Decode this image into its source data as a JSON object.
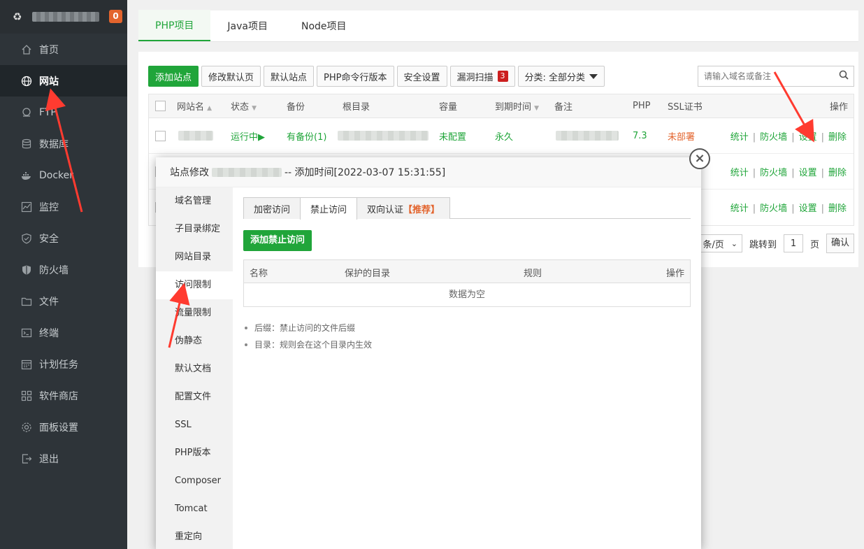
{
  "sidebar": {
    "badge": "0",
    "items": [
      {
        "label": "首页",
        "icon": "home-icon"
      },
      {
        "label": "网站",
        "icon": "globe-icon"
      },
      {
        "label": "FTP",
        "icon": "ftp-icon"
      },
      {
        "label": "数据库",
        "icon": "database-icon"
      },
      {
        "label": "Docker",
        "icon": "docker-icon"
      },
      {
        "label": "监控",
        "icon": "monitor-icon"
      },
      {
        "label": "安全",
        "icon": "shield-icon"
      },
      {
        "label": "防火墙",
        "icon": "firewall-icon"
      },
      {
        "label": "文件",
        "icon": "folder-icon"
      },
      {
        "label": "终端",
        "icon": "terminal-icon"
      },
      {
        "label": "计划任务",
        "icon": "calendar-icon"
      },
      {
        "label": "软件商店",
        "icon": "apps-icon"
      },
      {
        "label": "面板设置",
        "icon": "gear-icon"
      },
      {
        "label": "退出",
        "icon": "logout-icon"
      }
    ]
  },
  "project_tabs": [
    "PHP项目",
    "Java项目",
    "Node项目"
  ],
  "toolbar": {
    "add_site": "添加站点",
    "modify_default_page": "修改默认页",
    "default_site": "默认站点",
    "php_cli": "PHP命令行版本",
    "security": "安全设置",
    "vuln_scan": "漏洞扫描",
    "vuln_count": "3",
    "category": "分类: 全部分类"
  },
  "search": {
    "placeholder": "请输入域名或备注"
  },
  "table": {
    "headers": {
      "name": "网站名",
      "status": "状态",
      "backup": "备份",
      "root": "根目录",
      "capacity": "容量",
      "expire": "到期时间",
      "note": "备注",
      "php": "PHP",
      "ssl": "SSL证书",
      "ops": "操作"
    },
    "row": {
      "status": "运行中▶",
      "backup": "有备份(1)",
      "capacity": "未配置",
      "expire": "永久",
      "php": "7.3",
      "ssl": "未部署"
    },
    "ops": [
      "统计",
      "防火墙",
      "设置",
      "删除"
    ]
  },
  "pager": {
    "per_page": "条/页",
    "jump": "跳转到",
    "page_value": "1",
    "page_unit": "页",
    "confirm": "确认"
  },
  "modal": {
    "title_prefix": "站点修改",
    "title_suffix": "-- 添加时间[2022-03-07 15:31:55]",
    "close": "×",
    "menu": [
      "域名管理",
      "子目录绑定",
      "网站目录",
      "访问限制",
      "流量限制",
      "伪静态",
      "默认文档",
      "配置文件",
      "SSL",
      "PHP版本",
      "Composer",
      "Tomcat",
      "重定向"
    ],
    "tabs": {
      "encrypt": "加密访问",
      "deny": "禁止访问",
      "two_way": "双向认证",
      "recommend": "【推荐】"
    },
    "add_button": "添加禁止访问",
    "inner_headers": {
      "name": "名称",
      "dir": "保护的目录",
      "rule": "规则",
      "ops": "操作"
    },
    "empty": "数据为空",
    "tips": [
      "后缀：禁止访问的文件后缀",
      "目录：规则会在这个目录内生效"
    ]
  },
  "colors": {
    "accent": "#20a53a",
    "arrow": "#ff3b30",
    "sidebar": "#2e3439",
    "warning": "#e3642d"
  }
}
